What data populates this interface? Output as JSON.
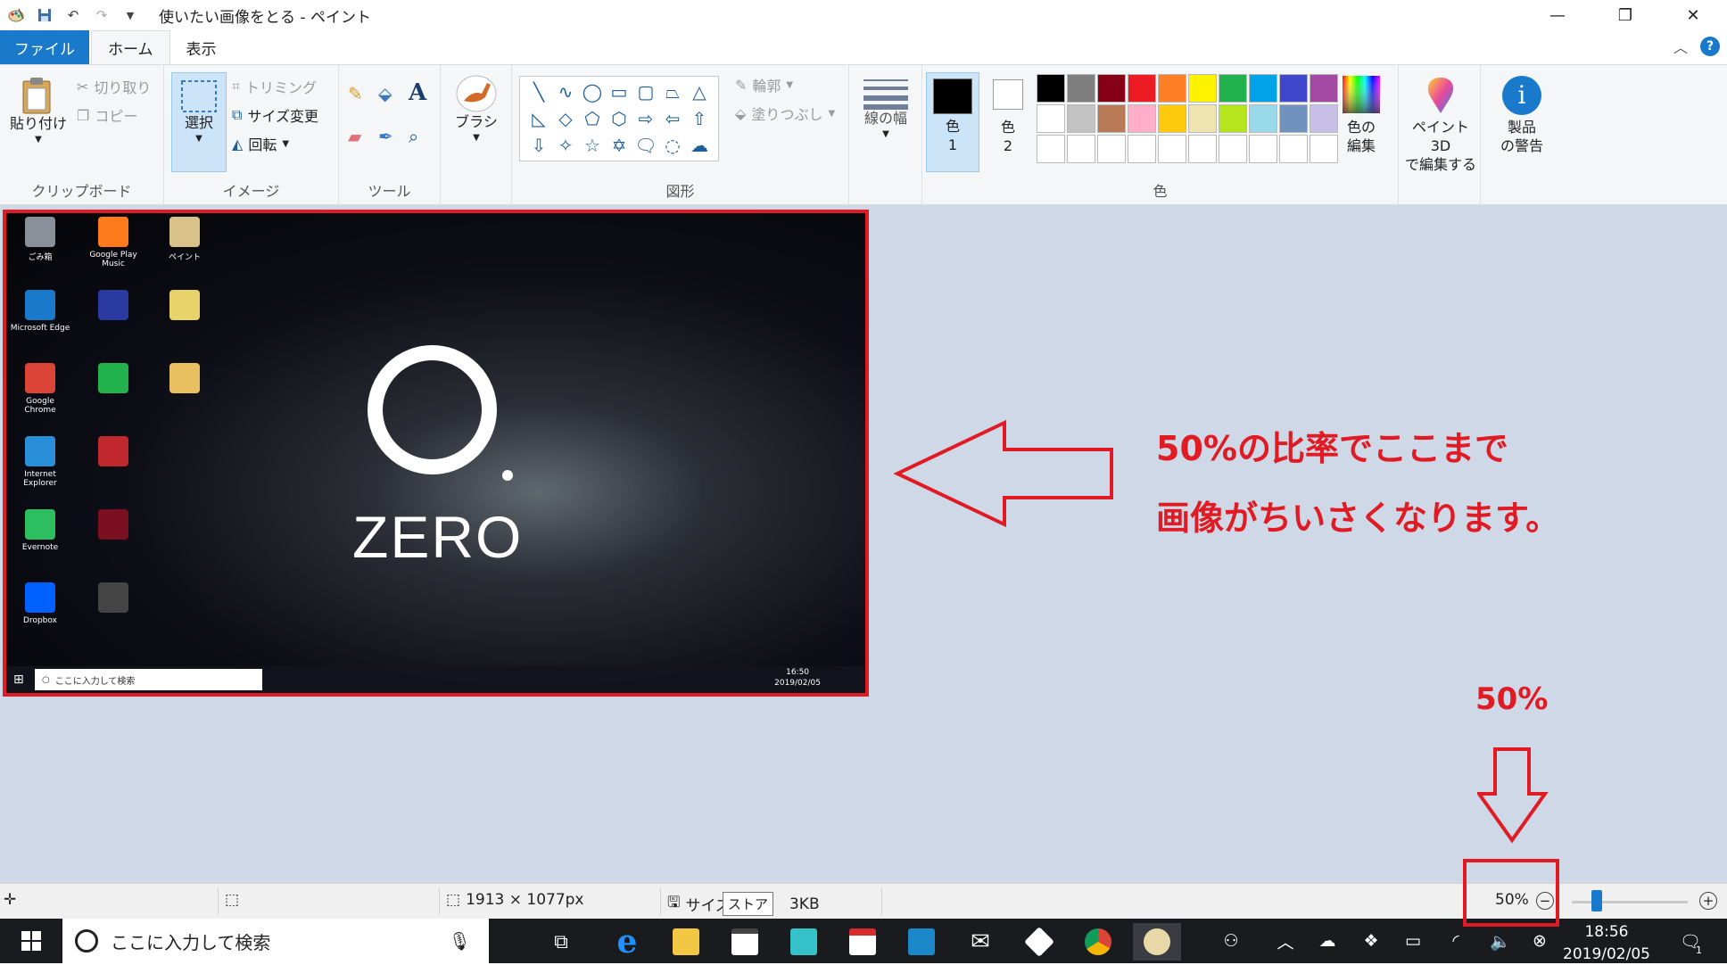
{
  "window": {
    "title": "使いたい画像をとる - ペイント",
    "minimize_glyph": "—",
    "maximize_glyph": "❐",
    "close_glyph": "✕"
  },
  "tabs": [
    {
      "label": "ファイル"
    },
    {
      "label": "ホーム"
    },
    {
      "label": "表示"
    }
  ],
  "ribbon": {
    "clipboard": {
      "label": "クリップボード",
      "paste": "貼り付け",
      "cut": "切り取り",
      "copy": "コピー"
    },
    "image": {
      "label": "イメージ",
      "select": "選択",
      "crop": "トリミング",
      "resize": "サイズ変更",
      "rotate": "回転"
    },
    "tools": {
      "label": "ツール"
    },
    "brushes": {
      "label": "ブラシ"
    },
    "shapes": {
      "label": "図形",
      "outline": "輪郭",
      "fill": "塗りつぶし"
    },
    "size": {
      "label": "線の幅"
    },
    "colors": {
      "label": "色",
      "color1_a": "色",
      "color1_b": "1",
      "color2_a": "色",
      "color2_b": "2",
      "edit_a": "色の",
      "edit_b": "編集",
      "palette": [
        "#000000",
        "#7f7f7f",
        "#880015",
        "#ed1c24",
        "#ff7f27",
        "#fff200",
        "#22b14c",
        "#00a2e8",
        "#3f48cc",
        "#a349a4",
        "#ffffff",
        "#c3c3c3",
        "#b97a57",
        "#ffaec9",
        "#ffc90e",
        "#efe4b0",
        "#b5e61d",
        "#99d9ea",
        "#7092be",
        "#c8bfe7",
        "#ffffff",
        "#ffffff",
        "#ffffff",
        "#ffffff",
        "#ffffff",
        "#ffffff",
        "#ffffff",
        "#ffffff",
        "#ffffff",
        "#ffffff"
      ],
      "color1": "#000000",
      "color2": "#ffffff"
    },
    "paint3d": {
      "line1": "ペイント 3D",
      "line2": "で編集する"
    },
    "warning": {
      "line1": "製品",
      "line2": "の警告"
    }
  },
  "picture": {
    "logo_text": "ZERO",
    "desktop_icons": [
      {
        "label": "ごみ箱",
        "color": "#8a9099"
      },
      {
        "label": "Google Play Music",
        "color": "#ff7a1a"
      },
      {
        "label": "ペイント",
        "color": "#d9c28a"
      },
      {
        "label": "Microsoft Edge",
        "color": "#1979ca"
      },
      {
        "label": "",
        "color": "#2b3aa0"
      },
      {
        "label": "",
        "color": "#e8d26a"
      },
      {
        "label": "Google Chrome",
        "color": "#db4437"
      },
      {
        "label": "",
        "color": "#22b14c"
      },
      {
        "label": "",
        "color": "#e8c060"
      },
      {
        "label": "Internet Explorer",
        "color": "#2a8fd9"
      },
      {
        "label": "",
        "color": "#c0282d"
      },
      {
        "label": "Evernote",
        "color": "#2dbe60"
      },
      {
        "label": "",
        "color": "#7a1020"
      },
      {
        "label": "Dropbox",
        "color": "#0061fe"
      },
      {
        "label": "",
        "color": "#444444"
      }
    ],
    "taskbar_search": "ここに入力して検索",
    "time": "16:50",
    "date": "2019/02/05"
  },
  "annotations": {
    "line1": "50%の比率でここまで",
    "line2": "画像がちいさくなります。",
    "zoom_callout": "50%",
    "color": "#e01b24"
  },
  "status": {
    "dimensions": "1913 × 1077px",
    "size_prefix": "サイズ",
    "size_suffix": "3KB",
    "zoom": "50%",
    "zoom_fraction": 0.5,
    "tooltip": "ストア"
  },
  "taskbar": {
    "search_placeholder": "ここに入力して検索",
    "time": "18:56",
    "date": "2019/02/05",
    "notification_count": "1"
  }
}
